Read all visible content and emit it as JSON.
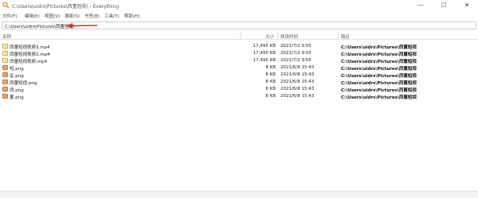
{
  "window": {
    "title": "C:\\Users\\uidrs\\Pictures\\西董短视\\ - Everything",
    "icon": "everything-search-icon"
  },
  "window_controls": {
    "minimize": "—",
    "maximize": "☐",
    "close": "✕"
  },
  "menu": [
    {
      "label": "文件(F)"
    },
    {
      "label": "编辑(E)"
    },
    {
      "label": "视图(V)"
    },
    {
      "label": "搜索(S)"
    },
    {
      "label": "书签(B)"
    },
    {
      "label": "工具(T)"
    },
    {
      "label": "帮助(H)"
    }
  ],
  "search": {
    "value": "C:\\Users\\uidrs\\Pictures\\西董短视\\"
  },
  "annotation": {
    "arrow_color": "#d9302c"
  },
  "columns": {
    "name": "名称",
    "size": "大小",
    "modified": "修改时间",
    "path": "路径"
  },
  "rows": [
    {
      "icon": "video-file-icon",
      "name": "西董短视视频3.mp4",
      "size": "17,495 KB",
      "modified": "2021/7/2 9:55",
      "path": "C:\\Users\\uidrs\\Pictures\\西董短视"
    },
    {
      "icon": "video-file-icon",
      "name": "西董短视视频2.mp4",
      "size": "17,495 KB",
      "modified": "2021/7/2 9:55",
      "path": "C:\\Users\\uidrs\\Pictures\\西董短视"
    },
    {
      "icon": "video-file-icon",
      "name": "西董短视视频.mp4",
      "size": "17,495 KB",
      "modified": "2021/7/2 9:55",
      "path": "C:\\Users\\uidrs\\Pictures\\西董短视"
    },
    {
      "icon": "image-file-icon",
      "name": "短.png",
      "size": "8 KB",
      "modified": "2021/6/8 15:43",
      "path": "C:\\Users\\uidrs\\Pictures\\西董短视"
    },
    {
      "icon": "image-file-icon",
      "name": "征.png",
      "size": "8 KB",
      "modified": "2021/6/8 15:43",
      "path": "C:\\Users\\uidrs\\Pictures\\西董短视"
    },
    {
      "icon": "image-file-icon",
      "name": "西董短视.png",
      "size": "8 KB",
      "modified": "2021/6/8 15:43",
      "path": "C:\\Users\\uidrs\\Pictures\\西董短视"
    },
    {
      "icon": "image-file-icon",
      "name": "西.png",
      "size": "8 KB",
      "modified": "2021/6/8 15:43",
      "path": "C:\\Users\\uidrs\\Pictures\\西董短视"
    },
    {
      "icon": "image-file-icon",
      "name": "董.png",
      "size": "8 KB",
      "modified": "2021/6/8 15:43",
      "path": "C:\\Users\\uidrs\\Pictures\\西董短视"
    }
  ]
}
